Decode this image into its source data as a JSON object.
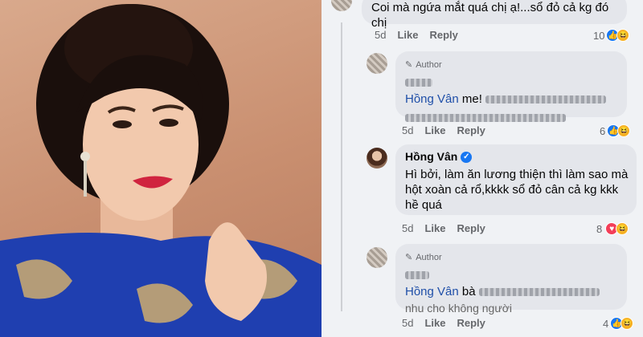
{
  "photo": {
    "alt_subject": ""
  },
  "comments": [
    {
      "id": "top",
      "avatar": "blurred-avatar",
      "text": "Coi mà ngứa mắt quá chị ạ!...sổ đỏ cả kg đó chị",
      "time": "5d",
      "like": "Like",
      "reply": "Reply",
      "reactions": "10",
      "reaction_icons": [
        "like-icon",
        "haha-icon"
      ]
    },
    {
      "id": "author-1",
      "avatar": "blurred-avatar",
      "badge": "Author",
      "mention": "Hồng Vân",
      "text_tail": "me!",
      "time": "5d",
      "like": "Like",
      "reply": "Reply",
      "reactions": "6",
      "reaction_icons": [
        "like-icon",
        "haha-icon"
      ]
    },
    {
      "id": "hong-van",
      "avatar": "hong-van-avatar",
      "name": "Hồng Vân",
      "text": "Hì bởi, làm ăn lương thiện thì làm sao mà hột xoàn cả rổ,kkkk sổ đỏ cân cả kg kkk hề quá",
      "time": "5d",
      "like": "Like",
      "reply": "Reply",
      "reactions": "8",
      "reaction_icons": [
        "love-icon",
        "haha-icon"
      ]
    },
    {
      "id": "author-2",
      "avatar": "blurred-avatar",
      "badge": "Author",
      "mention": "Hồng Vân",
      "text_mid": "bà",
      "text_tail": "nhu cho không người",
      "time": "5d",
      "like": "Like",
      "reply": "Reply",
      "reactions": "4",
      "reaction_icons": [
        "like-icon",
        "haha-icon"
      ]
    }
  ],
  "colors": {
    "like": "#1877f2",
    "haha": "#f7b125",
    "love": "#f33e58",
    "dress": "#1f3fb0",
    "bubble": "#e4e6eb"
  }
}
